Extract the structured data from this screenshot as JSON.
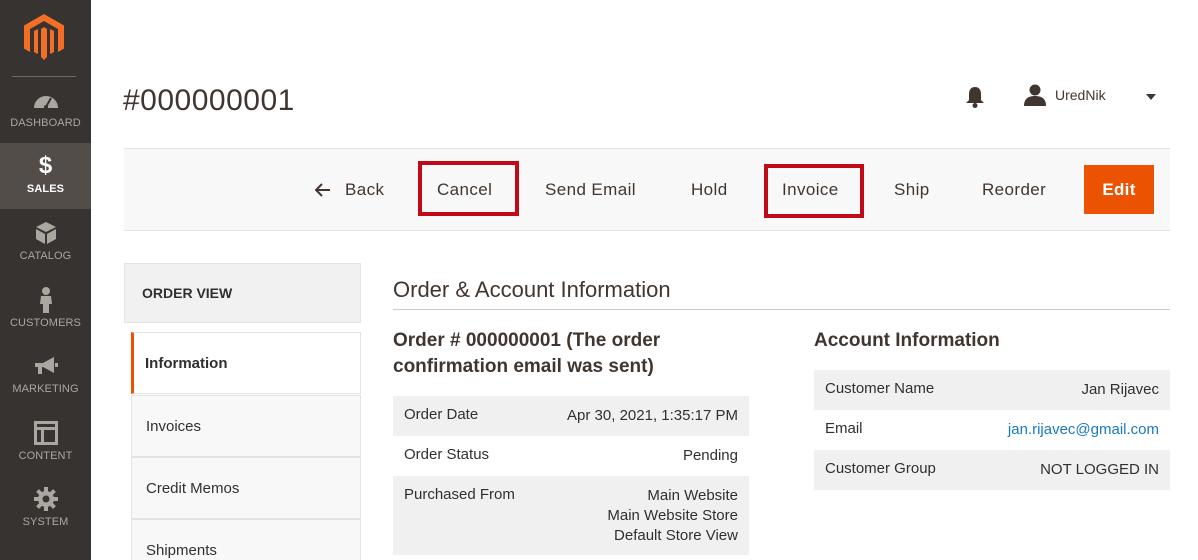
{
  "sidebar": {
    "items": [
      {
        "label": "DASHBOARD",
        "icon": "dashboard-icon"
      },
      {
        "label": "SALES",
        "icon": "dollar-icon",
        "glyph": "$",
        "active": true
      },
      {
        "label": "CATALOG",
        "icon": "box-icon"
      },
      {
        "label": "CUSTOMERS",
        "icon": "person-icon"
      },
      {
        "label": "MARKETING",
        "icon": "megaphone-icon"
      },
      {
        "label": "CONTENT",
        "icon": "layout-icon"
      },
      {
        "label": "SYSTEM",
        "icon": "gear-icon"
      }
    ]
  },
  "header": {
    "title": "#000000001",
    "user_name": "UredNik"
  },
  "actions": {
    "back": "Back",
    "cancel": "Cancel",
    "send_email": "Send Email",
    "hold": "Hold",
    "invoice": "Invoice",
    "ship": "Ship",
    "reorder": "Reorder",
    "edit": "Edit"
  },
  "tabs": {
    "title": "ORDER VIEW",
    "items": [
      "Information",
      "Invoices",
      "Credit Memos",
      "Shipments"
    ]
  },
  "main": {
    "section_title": "Order & Account Information",
    "order_heading": "Order # 000000001 (The order confirmation email was sent)",
    "order_rows": [
      {
        "label": "Order Date",
        "value": "Apr 30, 2021, 1:35:17 PM"
      },
      {
        "label": "Order Status",
        "value": "Pending"
      },
      {
        "label": "Purchased From",
        "value_lines": [
          "Main Website",
          "Main Website Store",
          "Default Store View"
        ]
      }
    ],
    "account_heading": "Account Information",
    "account_rows": [
      {
        "label": "Customer Name",
        "value": "Jan Rijavec"
      },
      {
        "label": "Email",
        "value": "jan.rijavec@gmail.com"
      },
      {
        "label": "Customer Group",
        "value": "NOT LOGGED IN"
      }
    ]
  },
  "colors": {
    "sidebar_bg": "#373330",
    "accent": "#eb5202",
    "highlight_box": "#c00a18",
    "link": "#1979c3"
  }
}
